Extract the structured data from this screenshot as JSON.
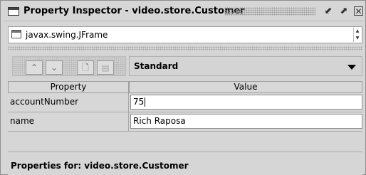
{
  "window": {
    "title": "Property Inspector - video.store.Customer",
    "icons": [
      "window-icon",
      "undock-icon",
      "maximize-icon",
      "close-icon"
    ]
  },
  "class_selector": {
    "value": "javax.swing.JFrame",
    "icon": "jframe-icon"
  },
  "toolbar": {
    "buttons": [
      {
        "name": "move-up",
        "icon": "chevron-up-icon"
      },
      {
        "name": "move-down",
        "icon": "chevron-down-icon"
      },
      {
        "name": "new-document",
        "icon": "document-icon"
      },
      {
        "name": "layout",
        "icon": "layout-icon"
      }
    ],
    "view_select": {
      "value": "Standard"
    }
  },
  "table": {
    "columns": [
      "Property",
      "Value"
    ],
    "rows": [
      {
        "property": "accountNumber",
        "value": "75"
      },
      {
        "property": "name",
        "value": "Rich Raposa"
      }
    ]
  },
  "status": {
    "text": "Properties for:  video.store.Customer"
  }
}
